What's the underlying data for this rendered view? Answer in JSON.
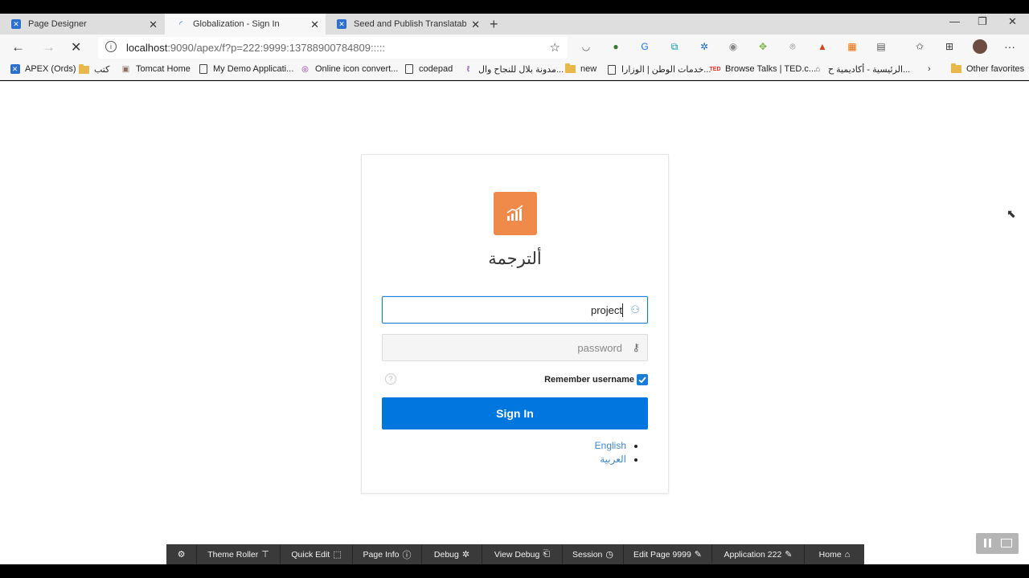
{
  "browser": {
    "tabs": [
      {
        "label": "Page Designer",
        "active": false,
        "icon": "apex-x-icon"
      },
      {
        "label": "Globalization - Sign In",
        "active": true,
        "icon": "loading-icon"
      },
      {
        "label": "Seed and Publish Translatable Te",
        "active": false,
        "icon": "apex-x-icon"
      }
    ],
    "url_host": "localhost",
    "url_rest": ":9090/apex/f?p=222:9999:13788900784809:::::",
    "bookmarks": [
      {
        "label": "APEX (Ords)",
        "icon": "apex-x-icon"
      },
      {
        "label": "كتب",
        "icon": "folder-icon"
      },
      {
        "label": "Tomcat Home",
        "icon": "tomcat-icon"
      },
      {
        "label": "My Demo Applicati...",
        "icon": "page-icon"
      },
      {
        "label": "Online icon convert...",
        "icon": "ring-icon"
      },
      {
        "label": "codepad",
        "icon": "page-icon"
      },
      {
        "label": "مدونة بلال للنجاح وال...",
        "icon": "blog-icon"
      },
      {
        "label": "new",
        "icon": "folder-icon"
      },
      {
        "label": "خدمات الوطن | الوزارا...",
        "icon": "page-icon"
      },
      {
        "label": "Browse Talks | TED.c...",
        "icon": "ted-icon"
      },
      {
        "label": "الرئيسية - أكاديمية ح...",
        "icon": "academy-icon"
      }
    ],
    "other_favorites": "Other favorites"
  },
  "login": {
    "app_title": "ألترجمة",
    "username_value": "project",
    "password_placeholder": "password",
    "help_glyph": "?",
    "remember_label": "Remember username",
    "remember_checked": true,
    "signin_label": "Sign In",
    "languages": [
      "English",
      "العربية"
    ],
    "accent_color": "#0076df",
    "logo_color": "#ef8a4a"
  },
  "devbar": {
    "items": [
      {
        "label": "",
        "icon": "gear-icon"
      },
      {
        "label": "Theme Roller",
        "icon": "paint-roller-icon"
      },
      {
        "label": "Quick Edit",
        "icon": "select-icon"
      },
      {
        "label": "Page Info",
        "icon": "info-icon"
      },
      {
        "label": "Debug",
        "icon": "bug-icon"
      },
      {
        "label": "View Debug",
        "icon": "view-debug-icon"
      },
      {
        "label": "Session",
        "icon": "clock-icon"
      },
      {
        "label": "Edit Page 9999",
        "icon": "edit-icon"
      },
      {
        "label": "Application 222",
        "icon": "edit-icon"
      },
      {
        "label": "Home",
        "icon": "home-icon"
      }
    ]
  }
}
